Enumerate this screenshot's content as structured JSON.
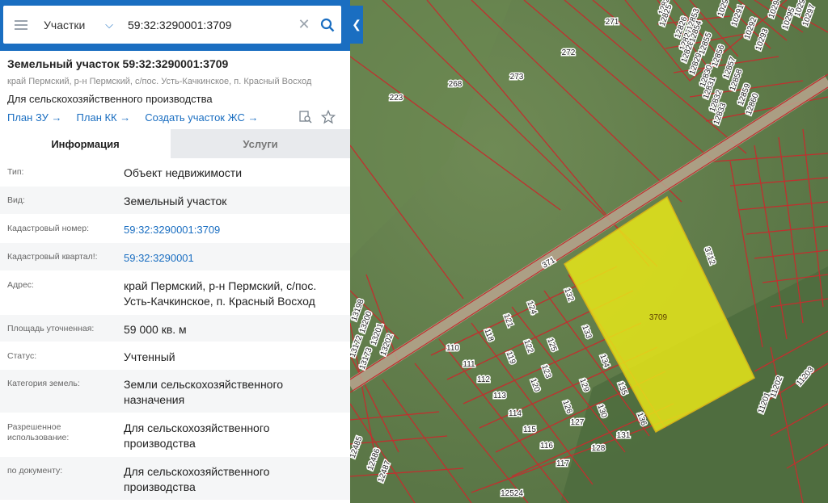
{
  "search": {
    "type_label": "Участки",
    "value": "59:32:3290001:3709"
  },
  "header": {
    "title": "Земельный участок 59:32:3290001:3709",
    "address": "край Пермский, р-н Пермский, с/пос. Усть-Качкинское, п. Красный Восход",
    "purpose": "Для сельскохозяйственного производства"
  },
  "links": [
    {
      "label": "План ЗУ →"
    },
    {
      "label": "План КК →"
    },
    {
      "label": "Создать участок ЖС →"
    }
  ],
  "tabs": [
    {
      "label": "Информация"
    },
    {
      "label": "Услуги"
    }
  ],
  "rows": [
    {
      "label": "Тип:",
      "value": "Объект недвижимости"
    },
    {
      "label": "Вид:",
      "value": "Земельный участок"
    },
    {
      "label": "Кадастровый номер:",
      "value": "59:32:3290001:3709"
    },
    {
      "label": "Кадастровый квартал!:",
      "value": "59:32:3290001"
    },
    {
      "label": "Адрес:",
      "value": "край Пермский, р-н Пермский, с/пос. Усть-Качкинское, п. Красный Восход"
    },
    {
      "label": "Площадь уточненная:",
      "value": "59 000 кв. м"
    },
    {
      "label": "Статус:",
      "value": "Учтенный"
    },
    {
      "label": "Категория земель:",
      "value": "Земли сельскохозяйственного назначения"
    },
    {
      "label": "Разрешенное использование:",
      "value": "Для сельскохозяйственного производства"
    },
    {
      "label": "по документу:",
      "value": "Для сельскохозяйственного производства"
    }
  ],
  "map": {
    "selected_label": "3709",
    "parcel_labels": [
      {
        "text": "271"
      },
      {
        "text": "272"
      },
      {
        "text": "273"
      },
      {
        "text": "268"
      },
      {
        "text": "223"
      },
      {
        "text": "371"
      },
      {
        "text": "3712"
      },
      {
        "text": "132"
      },
      {
        "text": "124"
      },
      {
        "text": "121"
      },
      {
        "text": "118"
      },
      {
        "text": "110"
      },
      {
        "text": "111"
      },
      {
        "text": "119"
      },
      {
        "text": "122"
      },
      {
        "text": "125"
      },
      {
        "text": "133"
      },
      {
        "text": "134"
      },
      {
        "text": "135"
      },
      {
        "text": "136"
      },
      {
        "text": "123"
      },
      {
        "text": "120"
      },
      {
        "text": "112"
      },
      {
        "text": "113"
      },
      {
        "text": "114"
      },
      {
        "text": "115"
      },
      {
        "text": "116"
      },
      {
        "text": "117"
      },
      {
        "text": "126"
      },
      {
        "text": "127"
      },
      {
        "text": "128"
      },
      {
        "text": "129"
      },
      {
        "text": "130"
      },
      {
        "text": "131"
      },
      {
        "text": "12524"
      },
      {
        "text": "11201"
      },
      {
        "text": "11202"
      },
      {
        "text": "11203"
      },
      {
        "text": "13198"
      },
      {
        "text": "13200"
      },
      {
        "text": "13201"
      },
      {
        "text": "13202"
      },
      {
        "text": "13172"
      },
      {
        "text": "13173"
      },
      {
        "text": "12485"
      },
      {
        "text": "12486"
      },
      {
        "text": "12487"
      },
      {
        "text": "12824"
      },
      {
        "text": "12825"
      },
      {
        "text": "12826"
      },
      {
        "text": "12827"
      },
      {
        "text": "12828"
      },
      {
        "text": "12829"
      },
      {
        "text": "12830"
      },
      {
        "text": "12831"
      },
      {
        "text": "12832"
      },
      {
        "text": "12833"
      },
      {
        "text": "12853"
      },
      {
        "text": "12854"
      },
      {
        "text": "12855"
      },
      {
        "text": "12856"
      },
      {
        "text": "12857"
      },
      {
        "text": "12858"
      },
      {
        "text": "12859"
      },
      {
        "text": "12860"
      },
      {
        "text": "10291"
      },
      {
        "text": "10292"
      },
      {
        "text": "10293"
      },
      {
        "text": "10294"
      },
      {
        "text": "10295"
      },
      {
        "text": "10296"
      },
      {
        "text": "10297"
      },
      {
        "text": "10290"
      }
    ]
  },
  "colors": {
    "accent": "#1a6ec1",
    "parcel_border": "#c0302f",
    "selected_fill": "#e6e619"
  }
}
